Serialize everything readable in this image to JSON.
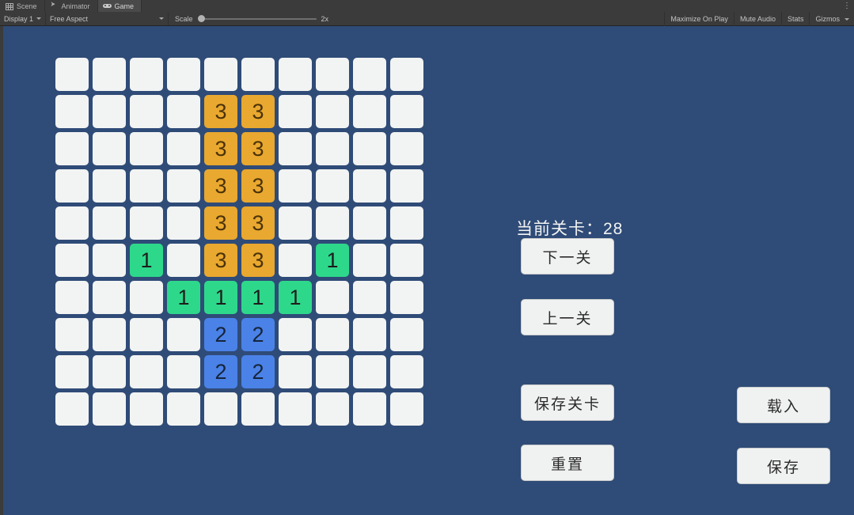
{
  "editor": {
    "tabs": [
      {
        "label": "Scene",
        "icon": "scene-grid-icon",
        "active": false
      },
      {
        "label": "Animator",
        "icon": "animator-arrow-icon",
        "active": false
      },
      {
        "label": "Game",
        "icon": "gamepad-icon",
        "active": true
      }
    ],
    "tab_overflow_menu": "⋮",
    "toolbar": {
      "display_selector": "Display 1",
      "aspect_selector": "Free Aspect",
      "scale_label": "Scale",
      "scale_value": "2x",
      "scale_knob_percent": 0,
      "maximize_on_play": "Maximize On Play",
      "mute_audio": "Mute Audio",
      "stats": "Stats",
      "gizmos": "Gizmos"
    }
  },
  "game": {
    "background_color": "#2F4B77",
    "level_text": "当前关卡：28",
    "buttons": {
      "next_level": "下一关",
      "prev_level": "上一关",
      "save_level": "保存关卡",
      "reset": "重置",
      "load": "载入",
      "save": "保存"
    },
    "board": {
      "rows": 10,
      "cols": 10,
      "empty_color": "#F2F4F3",
      "value_colors": {
        "1": "#2ED88B",
        "2": "#4A82E8",
        "3": "#E9A82F"
      },
      "cells": [
        [
          0,
          0,
          0,
          0,
          0,
          0,
          0,
          0,
          0,
          0
        ],
        [
          0,
          0,
          0,
          0,
          3,
          3,
          0,
          0,
          0,
          0
        ],
        [
          0,
          0,
          0,
          0,
          3,
          3,
          0,
          0,
          0,
          0
        ],
        [
          0,
          0,
          0,
          0,
          3,
          3,
          0,
          0,
          0,
          0
        ],
        [
          0,
          0,
          0,
          0,
          3,
          3,
          0,
          0,
          0,
          0
        ],
        [
          0,
          0,
          1,
          0,
          3,
          3,
          0,
          1,
          0,
          0
        ],
        [
          0,
          0,
          0,
          1,
          1,
          1,
          1,
          0,
          0,
          0
        ],
        [
          0,
          0,
          0,
          0,
          2,
          2,
          0,
          0,
          0,
          0
        ],
        [
          0,
          0,
          0,
          0,
          2,
          2,
          0,
          0,
          0,
          0
        ],
        [
          0,
          0,
          0,
          0,
          0,
          0,
          0,
          0,
          0,
          0
        ]
      ]
    }
  }
}
